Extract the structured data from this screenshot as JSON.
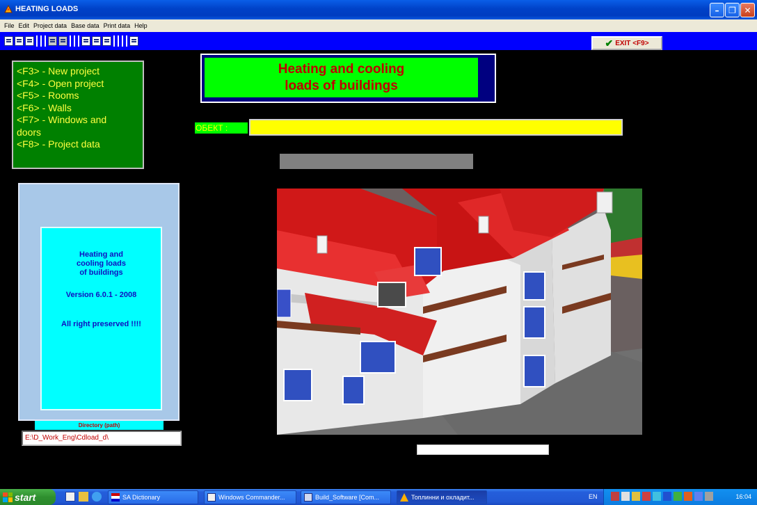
{
  "window": {
    "title": "HEATING LOADS",
    "minimize_icon": "minimize-icon",
    "maximize_icon": "maximize-icon",
    "close_icon": "close-icon"
  },
  "menu": [
    "File",
    "Edit",
    "Project data",
    "Base data",
    "Print data",
    "Help"
  ],
  "toolbar": {
    "exit_label": "EXIT <F9>",
    "colors": {
      "background": "#0000ff"
    }
  },
  "fkeys": [
    "<F3> - New project",
    "<F4> - Open project",
    "<F5> - Rooms",
    "<F6> - Walls",
    "<F7> - Windows and",
    "doors",
    "<F8> - Project data"
  ],
  "banner": {
    "line1": "Heating and cooling",
    "line2": "loads of buildings"
  },
  "object": {
    "label": "ОБЕКТ :",
    "value": ""
  },
  "about": {
    "line1": "Heating and",
    "line2": "cooling loads",
    "line3": "of buildings",
    "version": "Version 6.0.1 - 2008",
    "rights": "All right preserved !!!!"
  },
  "directory": {
    "label": "Directory (path)",
    "value": "E:\\D_Work_Eng\\Cdload_d\\"
  },
  "taskbar": {
    "start": "start",
    "tasks": [
      "SA Dictionary",
      "Windows Commander...",
      "Build_Software [Com...",
      "Топлинни и охладит..."
    ],
    "language": "EN",
    "time": "16:04"
  },
  "colors": {
    "green_panel": "#008000",
    "banner_green": "#00ff00",
    "banner_text": "#c00000",
    "object_field": "#ffff00",
    "about_bg": "#00ffff"
  }
}
